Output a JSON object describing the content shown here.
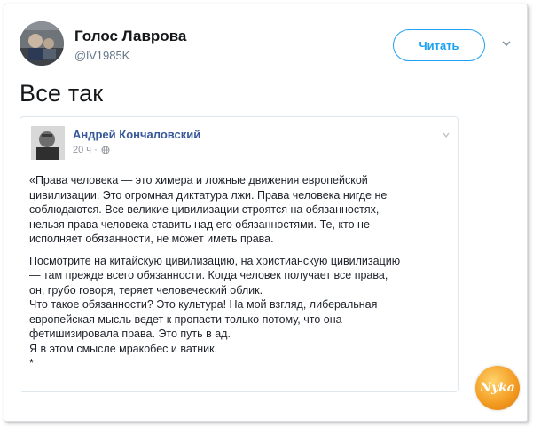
{
  "tweet": {
    "author_name": "Голос Лаврова",
    "author_handle": "@lV1985K",
    "follow_label": "Читать",
    "text": "Все так"
  },
  "quoted_post": {
    "author_name": "Андрей Кончаловский",
    "time": "20 ч ·",
    "paragraph1": [
      "«Права человека — это химера и ложные движения европейской",
      "цивилизации. Это огромная диктатура лжи. Права человека нигде не",
      "соблюдаются. Все великие цивилизации строятся на обязанностях,",
      "нельзя права человека ставить над его обязанностями. Те, кто не",
      "исполняет обязанности, не может иметь права."
    ],
    "paragraph2": [
      "Посмотрите на китайскую цивилизацию, на христианскую цивилизацию",
      "— там прежде всего обязанности. Когда человек получает все права,",
      "он, грубо говоря, теряет человеческий облик.",
      "Что такое обязанности? Это культура! На мой взгляд, либеральная",
      "европейская мысль ведет к пропасти только потому, что она",
      "фетишизировала права. Это путь в ад.",
      "Я в этом смысле мракобес и ватник.",
      "*"
    ]
  },
  "watermark": {
    "text": "Nyka"
  },
  "colors": {
    "accent": "#1da1f2",
    "fb_name": "#365899",
    "watermark": "#f29a1f"
  },
  "icons": {
    "tweet_menu": "chevron-down-icon",
    "post_menu": "chevron-down-icon",
    "privacy": "globe-icon"
  }
}
